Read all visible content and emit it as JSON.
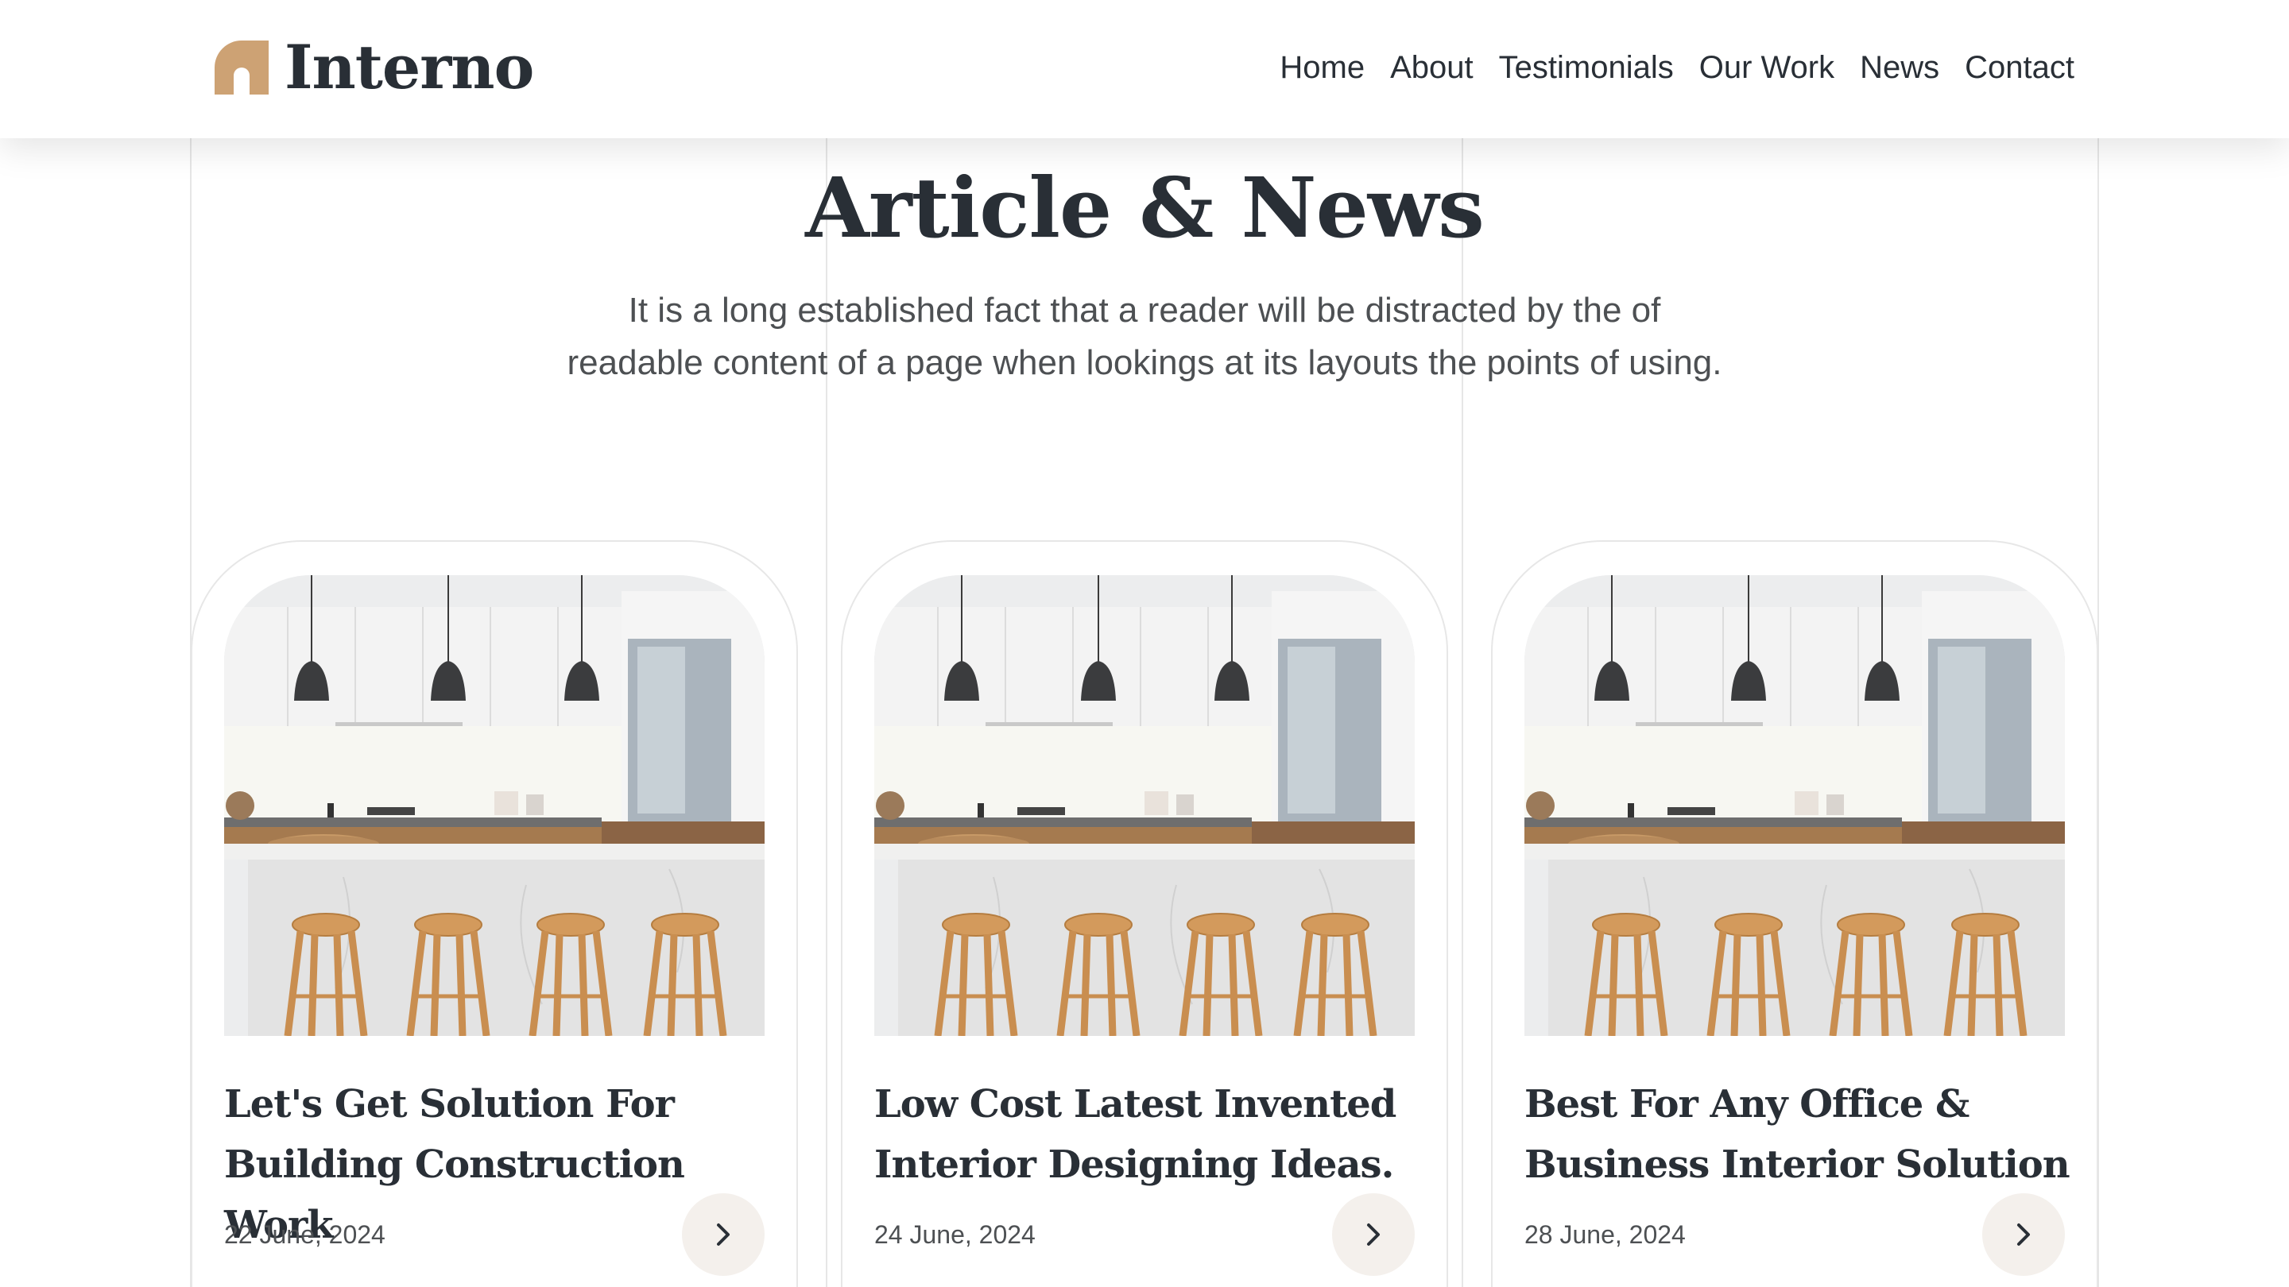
{
  "brand": {
    "name": "Interno",
    "accent_color": "#CDA274",
    "logo_icon": "arch-logo-icon"
  },
  "nav": {
    "items": [
      {
        "label": "Home"
      },
      {
        "label": "About"
      },
      {
        "label": "Testimonials"
      },
      {
        "label": "Our Work"
      },
      {
        "label": "News"
      },
      {
        "label": "Contact"
      }
    ]
  },
  "section": {
    "title": "Article & News",
    "description": "It is a long established fact that a reader will be distracted by the of readable content of a page when lookings at its layouts the points of using."
  },
  "articles": [
    {
      "title": "Let's Get Solution For Building Construction Work",
      "date": "22 June, 2024",
      "image": "kitchen-photo",
      "action_icon": "chevron-right-icon"
    },
    {
      "title": "Low Cost Latest Invented Interior Designing Ideas.",
      "date": "24 June, 2024",
      "image": "kitchen-photo",
      "action_icon": "chevron-right-icon"
    },
    {
      "title": "Best For Any Office & Business Interior Solution",
      "date": "28 June, 2024",
      "image": "kitchen-photo",
      "action_icon": "chevron-right-icon"
    }
  ],
  "colors": {
    "text_dark": "#292F36",
    "text_muted": "#4D5053",
    "button_bg": "#F4F0EC"
  }
}
